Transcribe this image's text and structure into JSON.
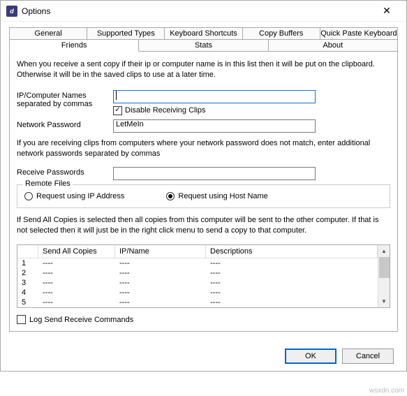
{
  "window": {
    "title": "Options",
    "close": "✕"
  },
  "tabs_row1": [
    "General",
    "Supported Types",
    "Keyboard Shortcuts",
    "Copy Buffers",
    "Quick Paste Keyboard"
  ],
  "tabs_row2": [
    "Friends",
    "Stats",
    "About"
  ],
  "active_tab": "Friends",
  "intro": "When you receive a sent copy if their ip or computer name is in this list then it will be put on the clipboard. Otherwise it will be in the saved clips to use at a later time.",
  "form": {
    "ip_names_label": "IP/Computer Names separated by commas",
    "ip_names_value": "",
    "disable_recv_label": "Disable Receiving Clips",
    "disable_recv_checked": true,
    "net_pw_label": "Network Password",
    "net_pw_value": "LetMeIn",
    "net_pw_note": "If you are receiving clips from computers where your network password does not match, enter additional network passwords separated by commas",
    "recv_pw_label": "Receive Passwords",
    "recv_pw_value": ""
  },
  "remote_files": {
    "legend": "Remote Files",
    "opt_ip": "Request using IP Address",
    "opt_host": "Request using Host Name",
    "selected": "host"
  },
  "send_all_note": "If Send All Copies is selected then all copies from this computer will be sent to the other computer.  If that is not selected then it will just be in the right click menu to send a copy to that computer.",
  "table": {
    "headers": [
      "",
      "Send All Copies",
      "IP/Name",
      "Descriptions"
    ],
    "rows": [
      {
        "n": "1",
        "a": "----",
        "b": "----",
        "c": "----"
      },
      {
        "n": "2",
        "a": "----",
        "b": "----",
        "c": "----"
      },
      {
        "n": "3",
        "a": "----",
        "b": "----",
        "c": "----"
      },
      {
        "n": "4",
        "a": "----",
        "b": "----",
        "c": "----"
      },
      {
        "n": "5",
        "a": "----",
        "b": "----",
        "c": "----"
      }
    ]
  },
  "log_label": "Log Send Receive Commands",
  "log_checked": false,
  "buttons": {
    "ok": "OK",
    "cancel": "Cancel"
  },
  "watermark": "wsxdn.com"
}
